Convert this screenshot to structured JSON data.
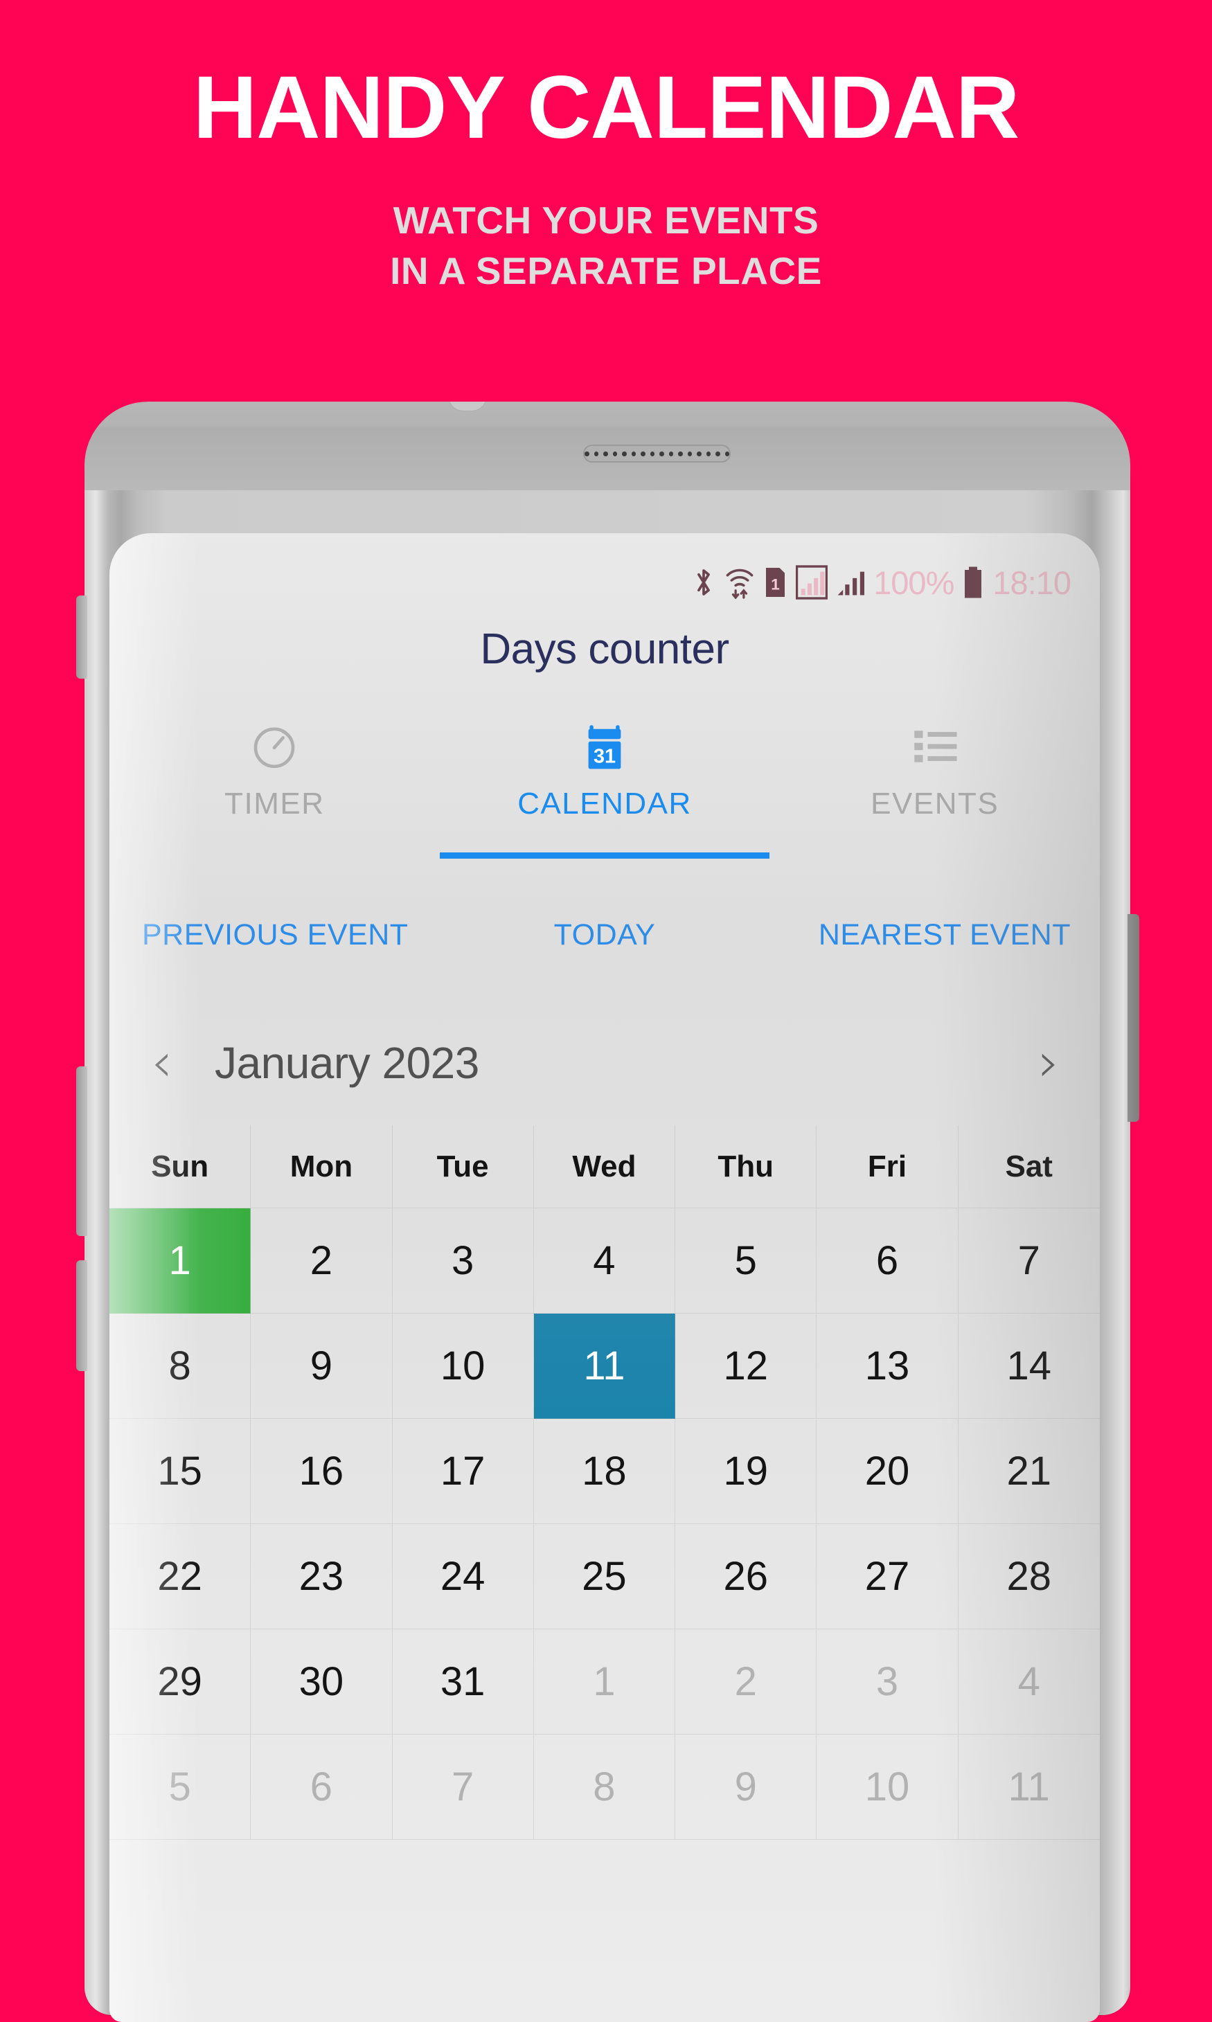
{
  "promo": {
    "title": "HANDY CALENDAR",
    "subtitle_line1": "WATCH YOUR EVENTS",
    "subtitle_line2": "IN A SEPARATE PLACE",
    "background_color": "#ff0355",
    "title_color": "#ffffff",
    "subtitle_color": "#dedede"
  },
  "status_bar": {
    "bluetooth_icon": "bluetooth-icon",
    "wifi_icon": "wifi-icon",
    "sim_label": "1",
    "signal_1_icon": "signal-bars-icon",
    "signal_2_icon": "signal-bars-icon",
    "battery_percent": "100%",
    "battery_icon": "battery-full-icon",
    "time": "18:10"
  },
  "app": {
    "title": "Days counter",
    "accent_color": "#1a8cf0",
    "tabs": [
      {
        "label": "TIMER",
        "icon": "timer-icon",
        "active": false
      },
      {
        "label": "CALENDAR",
        "icon": "calendar-31-icon",
        "active": true
      },
      {
        "label": "EVENTS",
        "icon": "list-icon",
        "active": false
      }
    ],
    "quick_actions": [
      {
        "label": "PREVIOUS EVENT"
      },
      {
        "label": "TODAY"
      },
      {
        "label": "NEAREST EVENT"
      }
    ],
    "month_nav": {
      "prev_icon": "chevron-left-icon",
      "next_icon": "chevron-right-icon",
      "month_label": "January 2023"
    },
    "calendar": {
      "weekdays": [
        "Sun",
        "Mon",
        "Tue",
        "Wed",
        "Thu",
        "Fri",
        "Sat"
      ],
      "event_day_color": "#37ae3f",
      "today_color": "#1c83ab",
      "weeks": [
        [
          {
            "day": "1",
            "state": "event"
          },
          {
            "day": "2",
            "state": "normal"
          },
          {
            "day": "3",
            "state": "normal"
          },
          {
            "day": "4",
            "state": "normal"
          },
          {
            "day": "5",
            "state": "normal"
          },
          {
            "day": "6",
            "state": "normal"
          },
          {
            "day": "7",
            "state": "normal"
          }
        ],
        [
          {
            "day": "8",
            "state": "normal"
          },
          {
            "day": "9",
            "state": "normal"
          },
          {
            "day": "10",
            "state": "normal"
          },
          {
            "day": "11",
            "state": "today"
          },
          {
            "day": "12",
            "state": "normal"
          },
          {
            "day": "13",
            "state": "normal"
          },
          {
            "day": "14",
            "state": "normal"
          }
        ],
        [
          {
            "day": "15",
            "state": "normal"
          },
          {
            "day": "16",
            "state": "normal"
          },
          {
            "day": "17",
            "state": "normal"
          },
          {
            "day": "18",
            "state": "normal"
          },
          {
            "day": "19",
            "state": "normal"
          },
          {
            "day": "20",
            "state": "normal"
          },
          {
            "day": "21",
            "state": "normal"
          }
        ],
        [
          {
            "day": "22",
            "state": "normal"
          },
          {
            "day": "23",
            "state": "normal"
          },
          {
            "day": "24",
            "state": "normal"
          },
          {
            "day": "25",
            "state": "normal"
          },
          {
            "day": "26",
            "state": "normal"
          },
          {
            "day": "27",
            "state": "normal"
          },
          {
            "day": "28",
            "state": "normal"
          }
        ],
        [
          {
            "day": "29",
            "state": "normal"
          },
          {
            "day": "30",
            "state": "normal"
          },
          {
            "day": "31",
            "state": "normal"
          },
          {
            "day": "1",
            "state": "muted"
          },
          {
            "day": "2",
            "state": "muted"
          },
          {
            "day": "3",
            "state": "muted"
          },
          {
            "day": "4",
            "state": "muted"
          }
        ],
        [
          {
            "day": "5",
            "state": "muted"
          },
          {
            "day": "6",
            "state": "muted"
          },
          {
            "day": "7",
            "state": "muted"
          },
          {
            "day": "8",
            "state": "muted"
          },
          {
            "day": "9",
            "state": "muted"
          },
          {
            "day": "10",
            "state": "muted"
          },
          {
            "day": "11",
            "state": "muted"
          }
        ]
      ]
    }
  }
}
